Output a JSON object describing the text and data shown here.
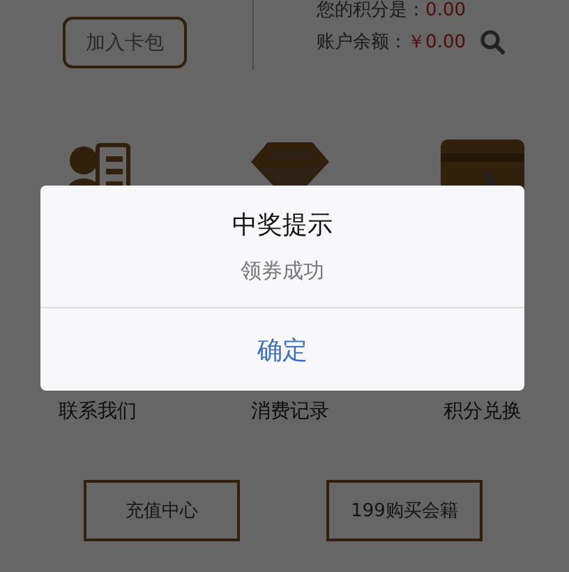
{
  "header": {
    "add_card_button": "加入卡包",
    "points_label": "您的积分是：",
    "points_value": "0.00",
    "balance_label": "账户余额：",
    "balance_value": "￥0.00"
  },
  "menu": [
    {
      "label": "联系我们"
    },
    {
      "label": "消费记录"
    },
    {
      "label": "积分兑换"
    }
  ],
  "buttons": [
    "充值中心",
    "199购买会籍"
  ],
  "dialog": {
    "title": "中奖提示",
    "message": "领券成功",
    "confirm": "确定"
  }
}
